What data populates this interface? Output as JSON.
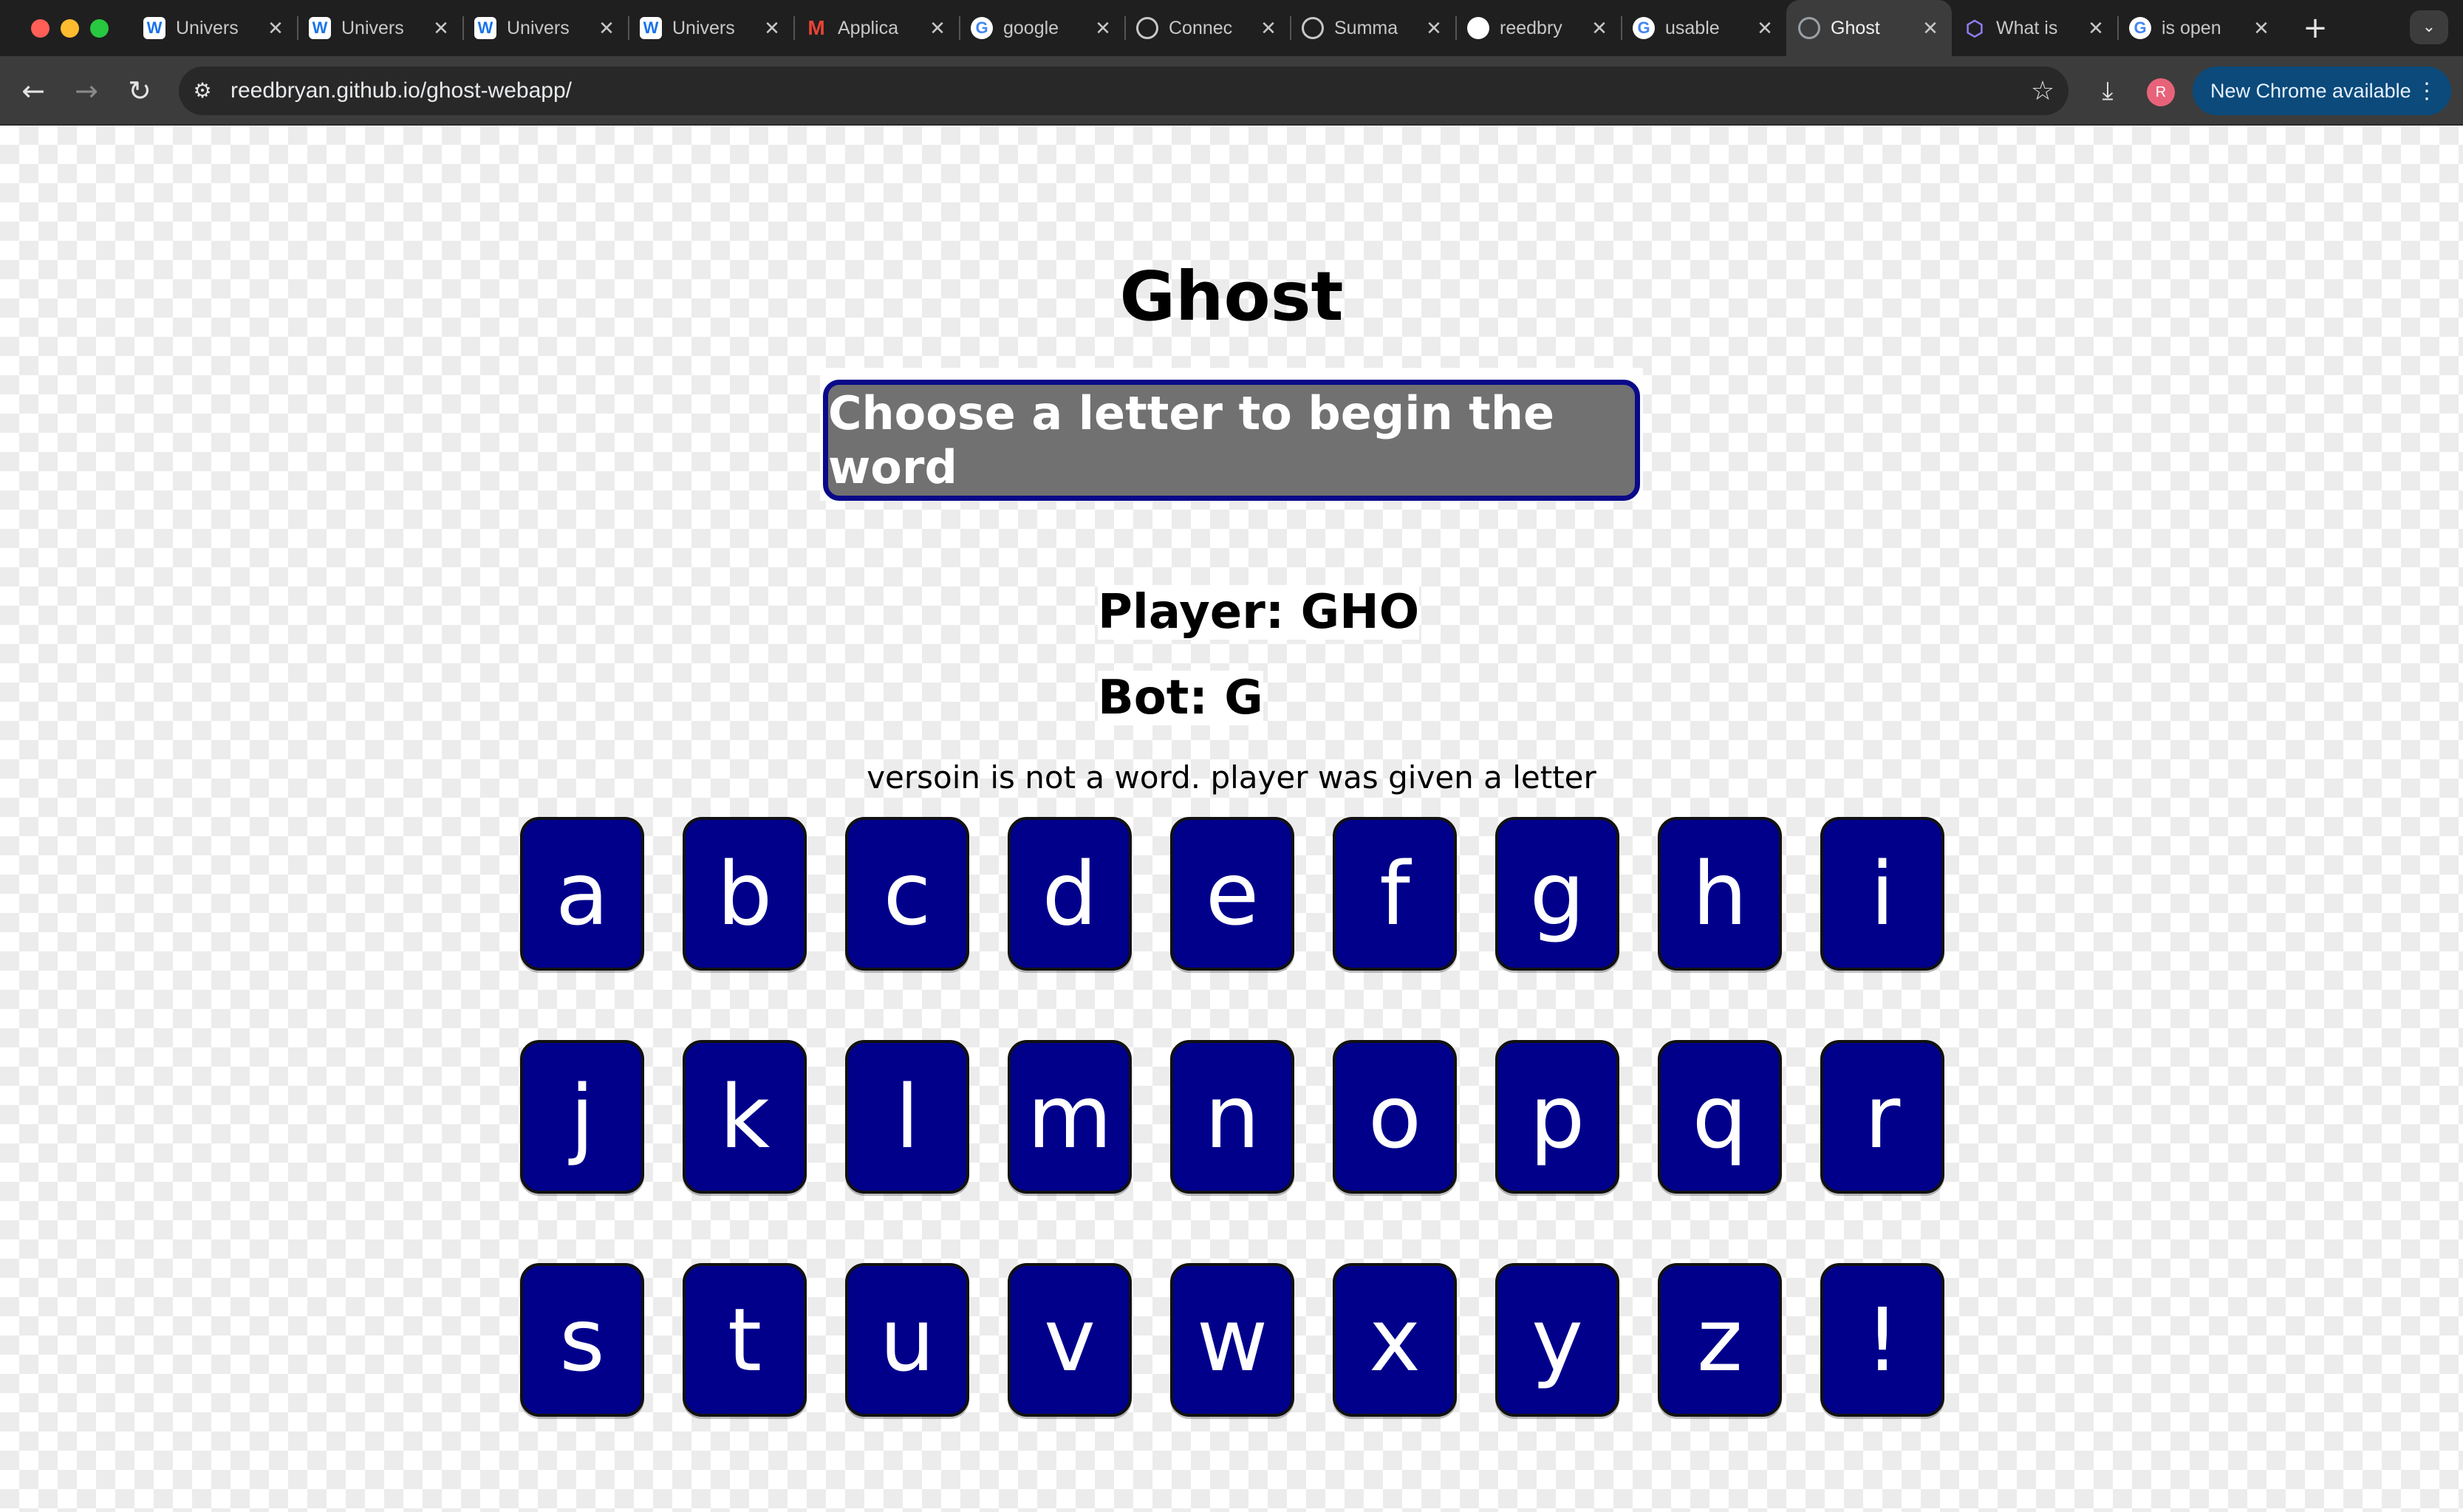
{
  "browser": {
    "tabs": [
      {
        "title": "Univers",
        "icon": "w-logo-icon",
        "favicon_glyph": "W"
      },
      {
        "title": "Univers",
        "icon": "w-logo-icon",
        "favicon_glyph": "W"
      },
      {
        "title": "Univers",
        "icon": "w-logo-icon",
        "favicon_glyph": "W"
      },
      {
        "title": "Univers",
        "icon": "w-logo-icon",
        "favicon_glyph": "W"
      },
      {
        "title": "Applica",
        "icon": "gmail-icon",
        "favicon_glyph": "M"
      },
      {
        "title": "google",
        "icon": "google-icon",
        "favicon_glyph": "G"
      },
      {
        "title": "Connec",
        "icon": "openai-icon",
        "favicon_glyph": ""
      },
      {
        "title": "Summa",
        "icon": "openai-icon",
        "favicon_glyph": ""
      },
      {
        "title": "reedbry",
        "icon": "github-icon",
        "favicon_glyph": ""
      },
      {
        "title": "usable",
        "icon": "google-icon",
        "favicon_glyph": "G"
      },
      {
        "title": "Ghost",
        "icon": "globe-icon",
        "favicon_glyph": "",
        "active": true
      },
      {
        "title": "What is",
        "icon": "cube-icon",
        "favicon_glyph": "⬡"
      },
      {
        "title": "is open",
        "icon": "google-icon",
        "favicon_glyph": "G"
      }
    ],
    "close_glyph": "✕",
    "new_tab_glyph": "+",
    "tab_search_glyph": "⌄",
    "nav": {
      "back": "←",
      "forward": "→",
      "reload": "↻"
    },
    "url": "reedbryan.github.io/ghost-webapp/",
    "bookmark_glyph": "☆",
    "download_glyph": "⤓",
    "profile_initial": "R",
    "update_label": "New Chrome available",
    "update_menu_glyph": "⋮",
    "site_info_glyph": "⚙"
  },
  "page": {
    "title": "Ghost",
    "prompt": "Choose a letter to begin the word",
    "player_score": "Player: GHO",
    "bot_score": "Bot: G",
    "message": "versoin is not a word. player was given a letter"
  },
  "keys": [
    "a",
    "b",
    "c",
    "d",
    "e",
    "f",
    "g",
    "h",
    "i",
    "j",
    "k",
    "l",
    "m",
    "n",
    "o",
    "p",
    "q",
    "r",
    "s",
    "t",
    "u",
    "v",
    "w",
    "x",
    "y",
    "z",
    "!"
  ],
  "colors": {
    "key_bg": "#00008b",
    "prompt_bg": "#717171",
    "prompt_border": "#0a0a8a"
  }
}
